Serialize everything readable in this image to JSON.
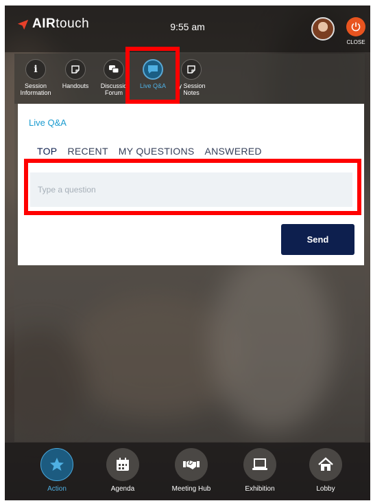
{
  "header": {
    "brand_bold": "AIR",
    "brand_light": "touch",
    "time": "9:55 am",
    "close_label": "CLOSE"
  },
  "session_tabs": [
    {
      "label_line1": "Session",
      "label_line2": "Information",
      "icon": "info-icon"
    },
    {
      "label_line1": "Handouts",
      "label_line2": "",
      "icon": "note-icon"
    },
    {
      "label_line1": "Discussio",
      "label_line2": "Forum",
      "icon": "chat-bubbles-icon"
    },
    {
      "label_line1": "Live Q&A",
      "label_line2": "",
      "icon": "chat-icon",
      "active": true
    },
    {
      "label_line1": "ly Session",
      "label_line2": "Notes",
      "icon": "note-icon"
    }
  ],
  "live_qa": {
    "title": "Live Q&A",
    "tabs": [
      "TOP",
      "RECENT",
      "MY QUESTIONS",
      "ANSWERED"
    ],
    "active_tab": "TOP",
    "input_placeholder": "Type a question",
    "input_value": "",
    "send_label": "Send"
  },
  "bottom_nav": [
    {
      "label": "Action",
      "icon": "star-icon",
      "active": true
    },
    {
      "label": "Agenda",
      "icon": "calendar-icon"
    },
    {
      "label": "Meeting Hub",
      "icon": "handshake-icon"
    },
    {
      "label": "Exhibition",
      "icon": "laptop-icon"
    },
    {
      "label": "Lobby",
      "icon": "home-icon"
    }
  ],
  "colors": {
    "accent": "#1a9bcf",
    "navy": "#0d1f4e",
    "close": "#e8541f",
    "highlight": "#ff0000"
  }
}
